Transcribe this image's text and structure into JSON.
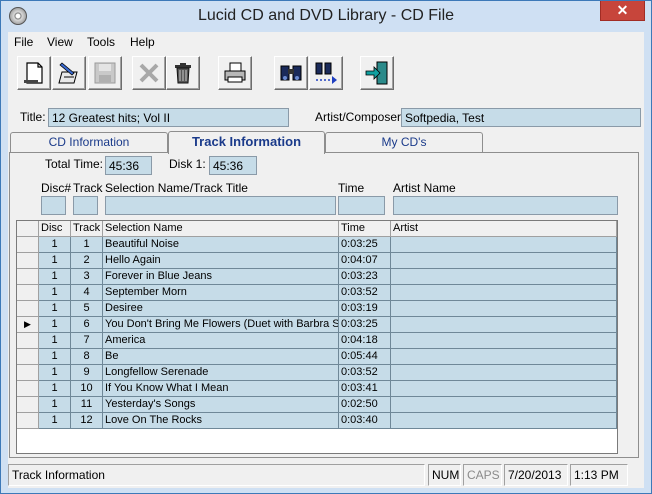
{
  "window": {
    "title": "Lucid CD and DVD Library - CD File",
    "close_glyph": "✕"
  },
  "menu": [
    "File",
    "View",
    "Tools",
    "Help"
  ],
  "toolbar": {
    "buttons": [
      "new-icon",
      "edit-icon",
      "save-icon",
      "delete-icon",
      "trash-icon",
      "print-icon",
      "find-icon",
      "find-next-icon",
      "exit-icon"
    ]
  },
  "header": {
    "title_label": "Title:",
    "title_value": "12 Greatest hits; Vol II",
    "artist_label": "Artist/Composer:",
    "artist_value": "Softpedia, Test"
  },
  "tabs": [
    {
      "label": "CD Information",
      "active": false
    },
    {
      "label": "Track Information",
      "active": true
    },
    {
      "label": "My CD's",
      "active": false
    }
  ],
  "track_info": {
    "total_time_label": "Total Time:",
    "total_time": "45:36",
    "disk_label": "Disk 1:",
    "disk_time": "45:36",
    "entry_headers": {
      "disc": "Disc#",
      "track": "Track",
      "title": "Selection Name/Track Title",
      "time": "Time",
      "artist": "Artist Name"
    }
  },
  "grid": {
    "columns": [
      "Disc",
      "Track",
      "Selection Name",
      "Time",
      "Artist"
    ],
    "current_row_marker": "▶",
    "current_row": 5,
    "rows": [
      {
        "disc": "1",
        "track": "1",
        "name": "Beautiful Noise",
        "time": "0:03:25",
        "artist": ""
      },
      {
        "disc": "1",
        "track": "2",
        "name": "Hello Again",
        "time": "0:04:07",
        "artist": ""
      },
      {
        "disc": "1",
        "track": "3",
        "name": "Forever in Blue Jeans",
        "time": "0:03:23",
        "artist": ""
      },
      {
        "disc": "1",
        "track": "4",
        "name": "September Morn",
        "time": "0:03:52",
        "artist": ""
      },
      {
        "disc": "1",
        "track": "5",
        "name": "Desiree",
        "time": "0:03:19",
        "artist": ""
      },
      {
        "disc": "1",
        "track": "6",
        "name": "You Don't Bring Me Flowers (Duet with Barbra Str",
        "time": "0:03:25",
        "artist": ""
      },
      {
        "disc": "1",
        "track": "7",
        "name": "America",
        "time": "0:04:18",
        "artist": ""
      },
      {
        "disc": "1",
        "track": "8",
        "name": "Be",
        "time": "0:05:44",
        "artist": ""
      },
      {
        "disc": "1",
        "track": "9",
        "name": "Longfellow Serenade",
        "time": "0:03:52",
        "artist": ""
      },
      {
        "disc": "1",
        "track": "10",
        "name": "If You Know What I Mean",
        "time": "0:03:41",
        "artist": ""
      },
      {
        "disc": "1",
        "track": "11",
        "name": "Yesterday's Songs",
        "time": "0:02:50",
        "artist": ""
      },
      {
        "disc": "1",
        "track": "12",
        "name": "Love On The Rocks",
        "time": "0:03:40",
        "artist": ""
      }
    ]
  },
  "status": {
    "message": "Track Information",
    "num": "NUM",
    "caps": "CAPS",
    "date": "7/20/2013",
    "time": "1:13 PM"
  },
  "colors": {
    "field_bg": "#c6dce8",
    "titlebar_bg": "#cfe0f3",
    "close_bg": "#c7453b",
    "tab_text": "#1a3a8a"
  }
}
